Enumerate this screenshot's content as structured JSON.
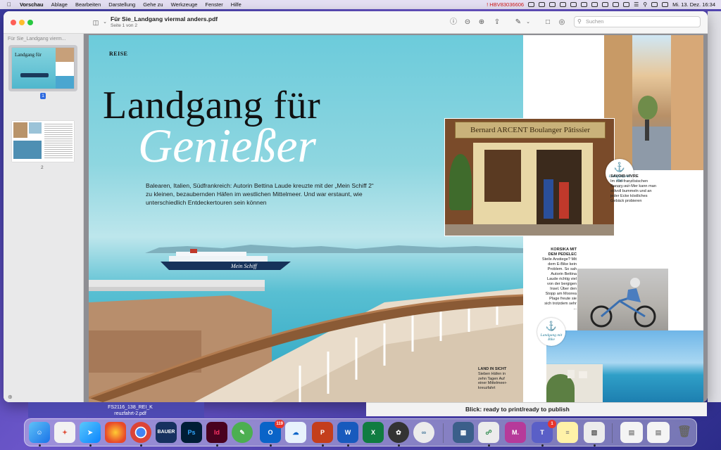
{
  "menubar": {
    "app": "Vorschau",
    "items": [
      "Ablage",
      "Bearbeiten",
      "Darstellung",
      "Gehe zu",
      "Werkzeuge",
      "Fenster",
      "Hilfe"
    ],
    "alert_text": "HBV83036606",
    "datetime": "Mi. 13. Dez.  16:34"
  },
  "window": {
    "title": "Für Sie_Landgang viermal anders.pdf",
    "subtitle": "Seite 1 von 2",
    "search_placeholder": "Suchen"
  },
  "sidebar": {
    "title": "Für Sie_Landgang vierm...",
    "pages": [
      {
        "label": "1",
        "thumb_title": "Landgang für"
      },
      {
        "label": "2"
      }
    ]
  },
  "document": {
    "section": "REISE",
    "headline_1": "Landgang für",
    "headline_2": "Genießer",
    "intro": "Balearen, Italien, Südfrankreich: Autorin Bettina Laude kreuzte mit der „Mein Schiff 2“ zu kleinen, bezaubernden Häfen im westlichen Mittelmeer. Und war erstaunt, wie unterschiedlich Entdeckertouren sein können",
    "ship_name": "Mein Schiff",
    "land_in_sicht_title": "LAND IN SICHT",
    "land_in_sicht_text": "Sieben Häfen in zehn Tagen Auf einer Mittelmeer-kreuzfahrt",
    "bakery_sign": "Bernard ARCENT Boulanger Pâtissier",
    "stamp_bei": "Landgang mit Biss",
    "stamp_bike": "Landgang mit Bike",
    "savoir_title": "SAVOIR-VIVRE",
    "savoir_text": "Im süd-französischen Sanary-sur-Mer kann man stilvoll bummeln und an jeder Ecke köstliches Gebäck probieren",
    "korsika_title": "KORSIKA MIT DEM PEDELEC",
    "korsika_text": "Steile Anstiege? Mit dem E-Bike kein Problem. So sah Autorin Bettina Laude richtig viel von der bergigen Insel. Über den Stopp am Moorea Plage freute sie sich trotzdem sehr ..."
  },
  "background_window": {
    "text": "Blick: ready to print/ready to publish"
  },
  "desktop_file": {
    "name_line1": "FS2116_138_REI_K",
    "name_line2": "reuzfahrt-2.pdf"
  },
  "dock": {
    "outlook_badge": "119",
    "teams_badge": "1",
    "bauer_label": "BAUER",
    "ps_label": "Ps",
    "id_label": "Id",
    "m_label": "M."
  },
  "colors": {
    "accent": "#2f6be0",
    "sea": "#58bfd2",
    "alert": "#d01818"
  }
}
